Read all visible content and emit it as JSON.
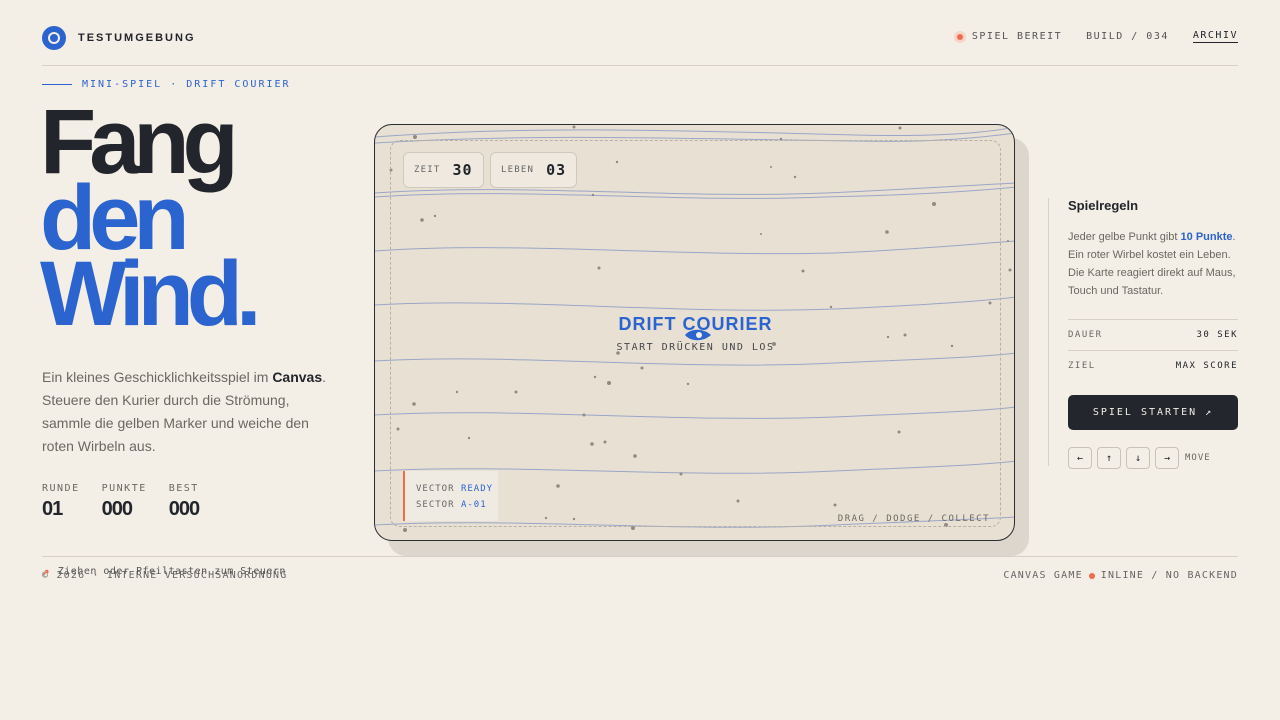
{
  "header": {
    "brand": "TESTUMGEBUNG",
    "status": "SPIEL BEREIT",
    "build": "BUILD / 034",
    "archive_link": "ARCHIV"
  },
  "eyebrow": "MINI-SPIEL · DRIFT COURIER",
  "headline": {
    "line1": "Fang",
    "line2": "den",
    "line3": "Wind."
  },
  "intro": {
    "before": "Ein kleines Geschicklichkeitsspiel im ",
    "bold": "Canvas",
    "after": ". Steuere den Kurier durch die Strömung, sammle die gelben Marker und weiche den roten Wirbeln aus."
  },
  "stats": [
    {
      "label": "RUNDE",
      "value": "01"
    },
    {
      "label": "PUNKTE",
      "value": "000"
    },
    {
      "label": "BEST",
      "value": "000"
    }
  ],
  "hint": "Ziehen oder Pfeiltasten zum Steuern",
  "game": {
    "hud_time_label": "ZEIT",
    "hud_time_value": "30",
    "hud_lives_label": "LEBEN",
    "hud_lives_value": "03",
    "title": "DRIFT COURIER",
    "subtitle": "START DRÜCKEN UND LOS",
    "vector_label": "VECTOR",
    "vector_value": "READY",
    "sector_label": "SECTOR",
    "sector_value": "A-01",
    "footer_label": "DRAG / DODGE / COLLECT"
  },
  "rules": {
    "title": "Spielregeln",
    "text_before": "Jeder gelbe Punkt gibt ",
    "text_highlight": "10 Punkte",
    "text_after": ". Ein roter Wirbel kostet ein Leben. Die Karte reagiert direkt auf Maus, Touch und Tastatur.",
    "duration_label": "DAUER",
    "duration_value": "30 SEK",
    "goal_label": "ZIEL",
    "goal_value": "MAX SCORE",
    "start_button": "SPIEL STARTEN ↗",
    "keys": [
      "←",
      "↑",
      "↓",
      "→"
    ],
    "keys_label": "MOVE"
  },
  "footer": {
    "left": "© 2026 · INTERNE VERSUCHSANORDNUNG",
    "right_a": "CANVAS GAME",
    "right_b": "INLINE / NO BACKEND"
  },
  "colors": {
    "background": "#f3eee6",
    "accent_blue": "#2b63cf",
    "accent_red": "#ef6a4f",
    "dark": "#22252b"
  }
}
